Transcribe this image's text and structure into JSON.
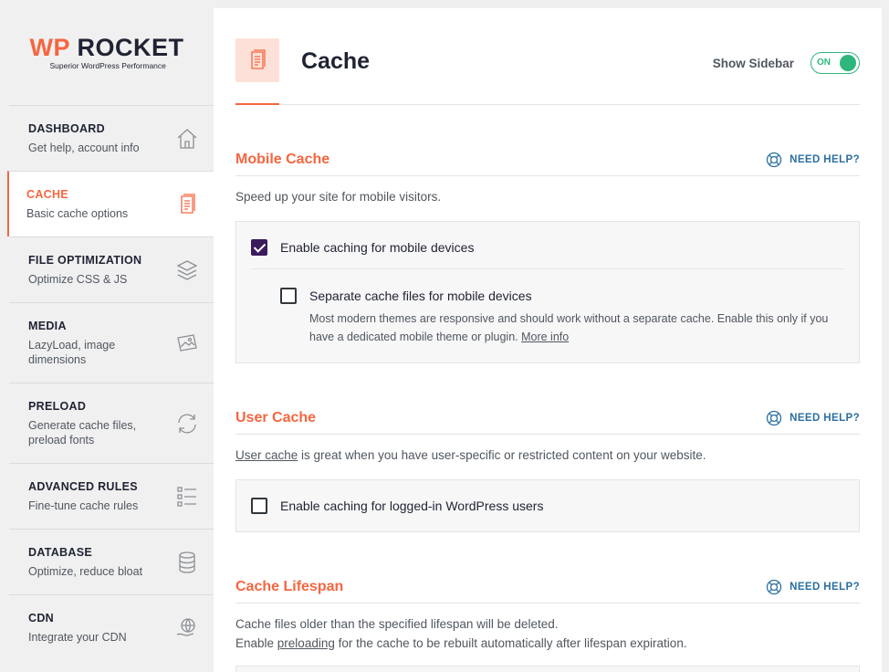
{
  "brand": {
    "name_part1": "WP",
    "name_part2": " ROCKET",
    "tagline": "Superior WordPress Performance"
  },
  "sidebar": {
    "items": [
      {
        "title": "DASHBOARD",
        "subtitle": "Get help, account info",
        "icon": "house-icon"
      },
      {
        "title": "CACHE",
        "subtitle": "Basic cache options",
        "icon": "document-icon",
        "active": true
      },
      {
        "title": "FILE OPTIMIZATION",
        "subtitle": "Optimize CSS & JS",
        "icon": "layers-icon"
      },
      {
        "title": "MEDIA",
        "subtitle": "LazyLoad, image dimensions",
        "icon": "image-icon"
      },
      {
        "title": "PRELOAD",
        "subtitle": "Generate cache files, preload fonts",
        "icon": "refresh-icon"
      },
      {
        "title": "ADVANCED RULES",
        "subtitle": "Fine-tune cache rules",
        "icon": "list-icon"
      },
      {
        "title": "DATABASE",
        "subtitle": "Optimize, reduce bloat",
        "icon": "database-icon"
      },
      {
        "title": "CDN",
        "subtitle": "Integrate your CDN",
        "icon": "globe-hand-icon"
      }
    ]
  },
  "header": {
    "title": "Cache",
    "sidebar_toggle_label": "Show Sidebar",
    "toggle_state": "ON"
  },
  "help_label": "NEED HELP?",
  "sections": {
    "mobile": {
      "title": "Mobile Cache",
      "desc": "Speed up your site for mobile visitors.",
      "opt1": {
        "label": "Enable caching for mobile devices",
        "checked": true
      },
      "opt2": {
        "label": "Separate cache files for mobile devices",
        "checked": false,
        "desc": "Most modern themes are responsive and should work without a separate cache. Enable this only if you have a dedicated mobile theme or plugin.",
        "link": "More info"
      }
    },
    "user": {
      "title": "User Cache",
      "desc_link": "User cache",
      "desc_rest": " is great when you have user-specific or restricted content on your website.",
      "opt1": {
        "label": "Enable caching for logged-in WordPress users",
        "checked": false
      }
    },
    "lifespan": {
      "title": "Cache Lifespan",
      "desc_line1": "Cache files older than the specified lifespan will be deleted.",
      "desc_line2_pre": "Enable ",
      "desc_line2_link": "preloading",
      "desc_line2_post": " for the cache to be rebuilt automatically after lifespan expiration."
    }
  },
  "colors": {
    "accent": "#f56640",
    "toggle": "#2fb67c",
    "checkbox": "#3a1b5d",
    "help": "#2b6fa0"
  }
}
